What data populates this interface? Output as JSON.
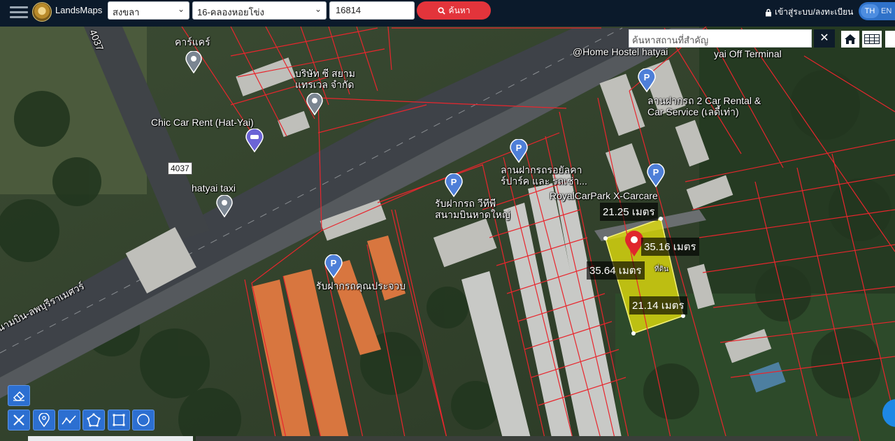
{
  "header": {
    "app_name": "LandsMaps",
    "province": "สงขลา",
    "district": "16-คลองหอยโข่ง",
    "parcel_number": "16814",
    "search_label": "ค้นหา",
    "login_label": "เข้าสู่ระบบ/ลงทะเบียน",
    "lang_selected": "TH",
    "lang_other": "EN"
  },
  "map": {
    "place_search_placeholder": "ค้นหาสถานที่สำคัญ",
    "close_symbol": "✕",
    "labels": {
      "car_care": "คาร์แคร์",
      "company_line1": "บริษัท ซี สยาม",
      "company_line2": "แทรเวล จำกัด",
      "chic_car_rent": "Chic Car Rent (Hat-Yai)",
      "road_4037_a": "4037",
      "road_4037_b": "4037",
      "road_4037_c": "4037",
      "hatyai_taxi": "hatyai taxi",
      "home_hostel": "@Home Hostel hatyai",
      "off_terminal": "yai Off Terminal",
      "parking_2car_line1": "ลานฝากรถ 2 Car Rental &",
      "parking_2car_line2": "Car Service (เลดี้เท่า)",
      "parking_royal_line1": "ลานฝากรถรอยัลคา",
      "parking_royal_line2": "ร์ปาร์ค และ รถเช่า...",
      "royal_carpark": "RoyalCarPark X-Carcare",
      "parking_tt_line1": "รับฝากรถ วีทีพี",
      "parking_tt_line2": "สนามบินหาดใหญ่",
      "parking_khun": "รับฝากรถคุณประจวบ",
      "highway": "สนามบิน-ลพบุรีราเมศวร์",
      "land_tag": "ที่ดิน"
    },
    "measurements": {
      "top": "21.25 เมตร",
      "right": "35.16 เมตร",
      "left": "35.64 เมตร",
      "bottom": "21.14 เมตร"
    }
  },
  "tools": [
    {
      "name": "eraser-tool",
      "icon": "eraser-icon"
    },
    {
      "name": "measure-tool",
      "icon": "ruler-icon"
    },
    {
      "name": "marker-tool",
      "icon": "pin-icon"
    },
    {
      "name": "line-tool",
      "icon": "polyline-icon"
    },
    {
      "name": "polygon-tool",
      "icon": "polygon-icon"
    },
    {
      "name": "rectangle-tool",
      "icon": "rectangle-icon"
    },
    {
      "name": "circle-tool",
      "icon": "circle-icon"
    }
  ],
  "colors": {
    "topbar": "#0b1a2b",
    "search_button": "#e3343b",
    "parcel_lines": "#e8262d",
    "selected_parcel": "#e6e20c",
    "marker": "#e0262c",
    "tool_button": "#2c6fd1"
  }
}
